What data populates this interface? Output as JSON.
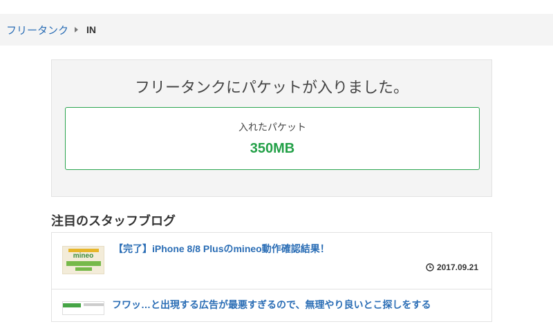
{
  "breadcrumb": {
    "parent_label": "フリータンク",
    "current_label": "IN"
  },
  "result": {
    "message": "フリータンクにパケットが入りました。",
    "packet_label": "入れたパケット",
    "packet_value": "350MB"
  },
  "staff_blog": {
    "section_title": "注目のスタッフブログ",
    "posts": [
      {
        "title": "【完了】iPhone 8/8 Plusのmineo動作確認結果！",
        "date": "2017.09.21",
        "thumbnail_text": "mineo"
      },
      {
        "title": "フワッ…と出現する広告が最悪すぎるので、無理やり良いとこ探しをする",
        "date": ""
      }
    ]
  },
  "colors": {
    "link": "#2a6db5",
    "accent_green": "#22a047",
    "panel_bg": "#f4f4f4"
  },
  "icons": {
    "breadcrumb_separator": "caret-right-icon",
    "date": "clock-icon"
  }
}
